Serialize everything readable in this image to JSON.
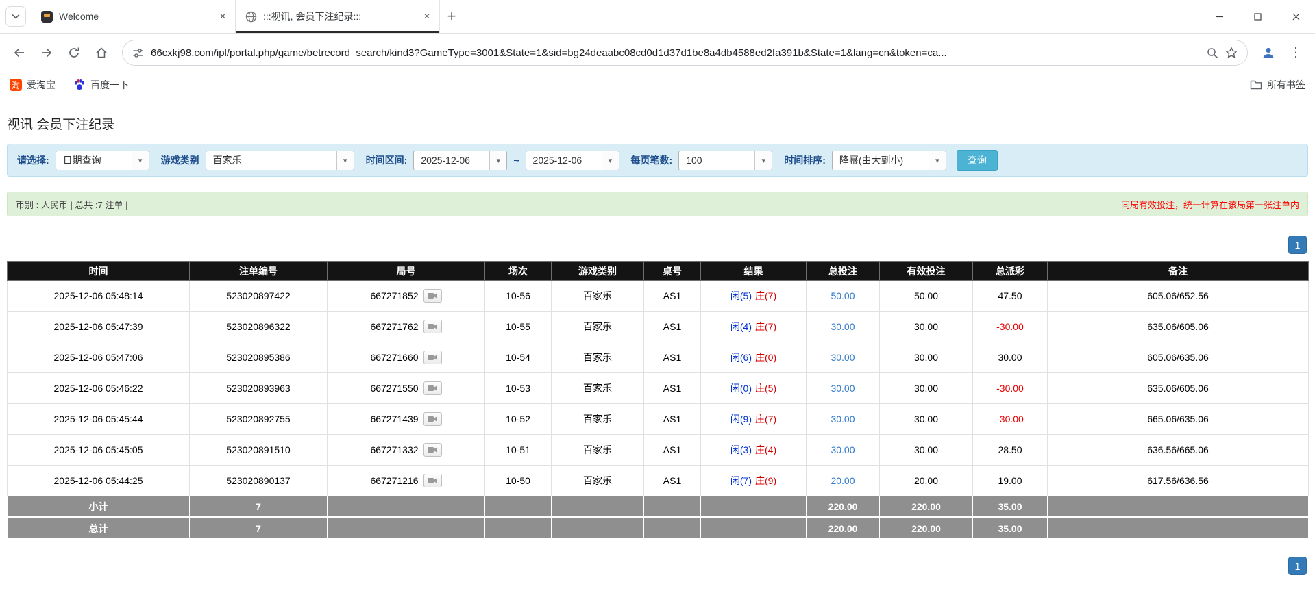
{
  "colors": {
    "accent_blue": "#337ab7",
    "link_blue": "#2f7ac9",
    "player_blue": "#0033cc",
    "banker_red": "#d40000",
    "negative_red": "#e60000",
    "query_button_teal": "#4cb3d4",
    "filter_bar_bg": "#d9edf7",
    "summary_bar_bg": "#dff0d8",
    "table_header_bg": "#141414",
    "table_footer_bg": "#8f8f8f"
  },
  "icons": {
    "close": "✕",
    "new_tab": "+",
    "menu": "⋮",
    "dropdown_arrow": "▾",
    "taobao_glyph": "淘"
  },
  "browser": {
    "tabs": [
      {
        "title": "Welcome"
      },
      {
        "title": ":::视讯, 会员下注纪录:::"
      }
    ],
    "url": "66cxkj98.com/ipl/portal.php/game/betrecord_search/kind3?GameType=3001&State=1&sid=bg24deaabc08cd0d1d37d1be8a4db4588ed2fa391b&State=1&lang=cn&token=ca...",
    "bookmarks": [
      {
        "label": "爱淘宝"
      },
      {
        "label": "百度一下"
      }
    ],
    "all_bookmarks_label": "所有书签"
  },
  "page": {
    "title": "视讯 会员下注纪录",
    "filters": {
      "select_label": "请选择:",
      "select_value": "日期查询",
      "game_label": "游戏类别",
      "game_value": "百家乐",
      "range_label": "时间区间:",
      "date_from": "2025-12-06",
      "range_separator": "~",
      "date_to": "2025-12-06",
      "per_page_label": "每页笔数:",
      "per_page_value": "100",
      "sort_label": "时间排序:",
      "sort_value": "降幂(由大到小)",
      "query_button": "查询"
    },
    "summary": {
      "left": "币别 : 人民币 | 总共 :7 注单 |",
      "right": "同局有效投注，统一计算在该局第一张注单内"
    },
    "pagination": {
      "page": "1"
    },
    "table": {
      "headers": [
        "时间",
        "注单编号",
        "局号",
        "场次",
        "游戏类别",
        "桌号",
        "结果",
        "总投注",
        "有效投注",
        "总派彩",
        "备注"
      ],
      "rows": [
        {
          "time": "2025-12-06 05:48:14",
          "bet_id": "523020897422",
          "round_id": "667271852",
          "session": "10-56",
          "game": "百家乐",
          "table_no": "AS1",
          "player": "闲(5)",
          "banker": "庄(7)",
          "total_bet": "50.00",
          "valid_bet": "50.00",
          "payout": "47.50",
          "note": "605.06/652.56"
        },
        {
          "time": "2025-12-06 05:47:39",
          "bet_id": "523020896322",
          "round_id": "667271762",
          "session": "10-55",
          "game": "百家乐",
          "table_no": "AS1",
          "player": "闲(4)",
          "banker": "庄(7)",
          "total_bet": "30.00",
          "valid_bet": "30.00",
          "payout": "-30.00",
          "note": "635.06/605.06"
        },
        {
          "time": "2025-12-06 05:47:06",
          "bet_id": "523020895386",
          "round_id": "667271660",
          "session": "10-54",
          "game": "百家乐",
          "table_no": "AS1",
          "player": "闲(6)",
          "banker": "庄(0)",
          "total_bet": "30.00",
          "valid_bet": "30.00",
          "payout": "30.00",
          "note": "605.06/635.06"
        },
        {
          "time": "2025-12-06 05:46:22",
          "bet_id": "523020893963",
          "round_id": "667271550",
          "session": "10-53",
          "game": "百家乐",
          "table_no": "AS1",
          "player": "闲(0)",
          "banker": "庄(5)",
          "total_bet": "30.00",
          "valid_bet": "30.00",
          "payout": "-30.00",
          "note": "635.06/605.06"
        },
        {
          "time": "2025-12-06 05:45:44",
          "bet_id": "523020892755",
          "round_id": "667271439",
          "session": "10-52",
          "game": "百家乐",
          "table_no": "AS1",
          "player": "闲(9)",
          "banker": "庄(7)",
          "total_bet": "30.00",
          "valid_bet": "30.00",
          "payout": "-30.00",
          "note": "665.06/635.06"
        },
        {
          "time": "2025-12-06 05:45:05",
          "bet_id": "523020891510",
          "round_id": "667271332",
          "session": "10-51",
          "game": "百家乐",
          "table_no": "AS1",
          "player": "闲(3)",
          "banker": "庄(4)",
          "total_bet": "30.00",
          "valid_bet": "30.00",
          "payout": "28.50",
          "note": "636.56/665.06"
        },
        {
          "time": "2025-12-06 05:44:25",
          "bet_id": "523020890137",
          "round_id": "667271216",
          "session": "10-50",
          "game": "百家乐",
          "table_no": "AS1",
          "player": "闲(7)",
          "banker": "庄(9)",
          "total_bet": "20.00",
          "valid_bet": "20.00",
          "payout": "19.00",
          "note": "617.56/636.56"
        }
      ],
      "subtotal": {
        "label": "小计",
        "count": "7",
        "total_bet": "220.00",
        "valid_bet": "220.00",
        "payout": "35.00"
      },
      "total": {
        "label": "总计",
        "count": "7",
        "total_bet": "220.00",
        "valid_bet": "220.00",
        "payout": "35.00"
      }
    }
  }
}
